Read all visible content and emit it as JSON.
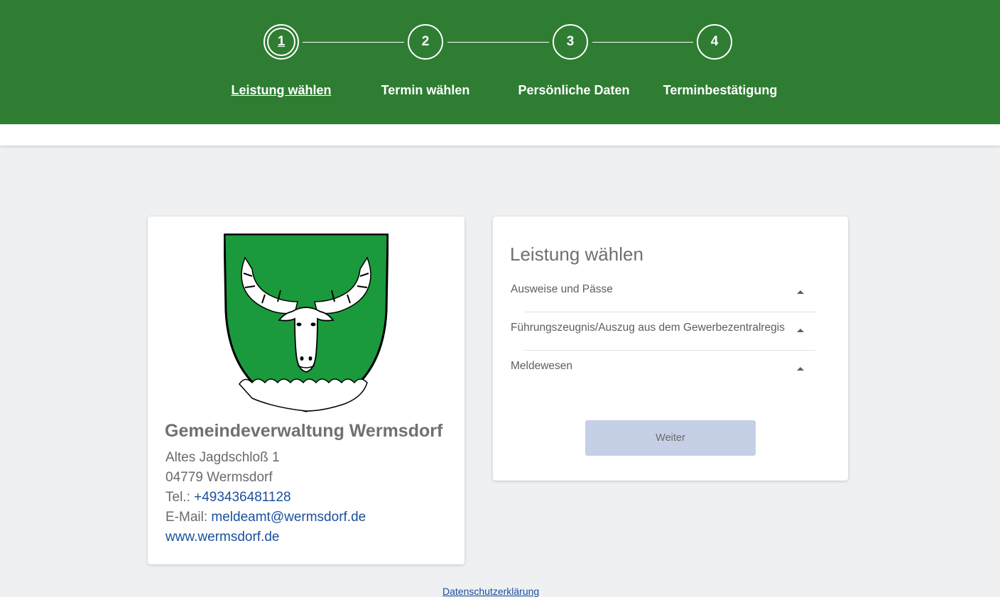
{
  "steps": [
    {
      "number": "1",
      "label": "Leistung wählen"
    },
    {
      "number": "2",
      "label": "Termin wählen"
    },
    {
      "number": "3",
      "label": "Persönliche Daten"
    },
    {
      "number": "4",
      "label": "Terminbestätigung"
    }
  ],
  "office": {
    "name": "Gemeindeverwaltung Wermsdorf",
    "street": "Altes Jagdschloß 1",
    "city": "04779 Wermsdorf",
    "phone_label": "Tel.: ",
    "phone": "+493436481128",
    "email_label": "E-Mail: ",
    "email": "meldeamt@wermsdorf.de",
    "website": "www.wermsdorf.de"
  },
  "services": {
    "title": "Leistung wählen",
    "items": [
      {
        "label": "Ausweise und Pässe"
      },
      {
        "label": "Führungszeugnis/Auszug aus dem Gewerbezentralregis"
      },
      {
        "label": "Meldewesen"
      }
    ],
    "next_button": "Weiter"
  },
  "footer": {
    "privacy_link": "Datenschutzerklärung"
  },
  "colors": {
    "header_green": "#2e7d32",
    "link_blue": "#1b4f9c",
    "crest_green": "#1a9a3c"
  }
}
